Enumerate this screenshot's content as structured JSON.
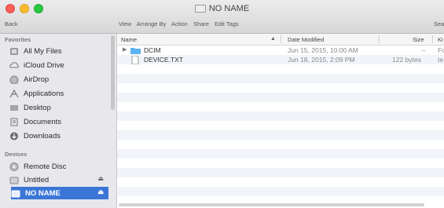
{
  "window": {
    "title": "NO NAME",
    "back_label": "Back",
    "toolbar": [
      "View",
      "Arrange By",
      "Action",
      "Share",
      "Edit Tags"
    ],
    "search_label": "Sea"
  },
  "sidebar": {
    "favorites_title": "Favorites",
    "favorites": [
      {
        "label": "All My Files",
        "icon": "all-my-files-icon"
      },
      {
        "label": "iCloud Drive",
        "icon": "cloud-icon"
      },
      {
        "label": "AirDrop",
        "icon": "airdrop-icon"
      },
      {
        "label": "Applications",
        "icon": "applications-icon"
      },
      {
        "label": "Desktop",
        "icon": "desktop-icon"
      },
      {
        "label": "Documents",
        "icon": "documents-icon"
      },
      {
        "label": "Downloads",
        "icon": "downloads-icon"
      }
    ],
    "devices_title": "Devices",
    "devices": [
      {
        "label": "Remote Disc",
        "icon": "remote-disc-icon",
        "eject": ""
      },
      {
        "label": "Untitled",
        "icon": "drive-icon",
        "eject": "⏏"
      },
      {
        "label": "NO NAME",
        "icon": "drive-icon",
        "eject": "⏏",
        "selected": true
      }
    ]
  },
  "files": {
    "columns": {
      "name": "Name",
      "date": "Date Modified",
      "size": "Size",
      "kind": "Ki"
    },
    "rows": [
      {
        "name": "DCIM",
        "date": "Jun 15, 2015, 10:00 AM",
        "size": "--",
        "kind": "Fo",
        "type": "folder"
      },
      {
        "name": "DEVICE.TXT",
        "date": "Jun 18, 2015, 2:09 PM",
        "size": "122 bytes",
        "kind": "te",
        "type": "file"
      }
    ]
  },
  "colors": {
    "selection": "#3b76d6",
    "sidebar": "#e8e8ec",
    "stripe": "#f1f4f9"
  }
}
